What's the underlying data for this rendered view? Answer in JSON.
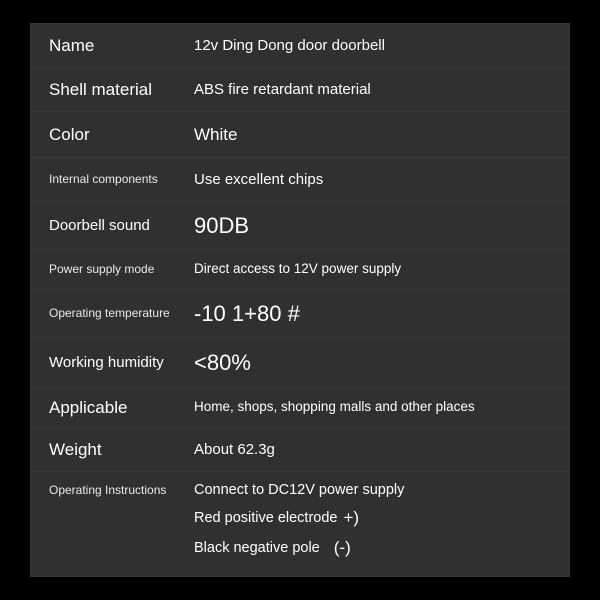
{
  "rows": {
    "name": {
      "label": "Name",
      "value": "12v Ding Dong door doorbell"
    },
    "shell": {
      "label": "Shell material",
      "value": "ABS fire retardant material"
    },
    "color": {
      "label": "Color",
      "value": "White"
    },
    "internal": {
      "label": "Internal components",
      "value": "Use excellent chips"
    },
    "sound": {
      "label": "Doorbell sound",
      "value": "90DB"
    },
    "power": {
      "label": "Power supply mode",
      "value": "Direct access to 12V power supply"
    },
    "temp": {
      "label": "Operating temperature",
      "value": "-10 1+80 #"
    },
    "humidity": {
      "label": "Working humidity",
      "value": "<80%"
    },
    "applicable": {
      "label": "Applicable",
      "value": "Home, shops, shopping malls and other places"
    },
    "weight": {
      "label": "Weight",
      "value": "About 62.3g"
    },
    "instructions": {
      "label": "Operating Instructions",
      "line1": "Connect to DC12V power supply",
      "line2_text": "Red positive electrode",
      "line2_sym": "+)",
      "line3_text": "Black negative pole",
      "line3_sym": "(-)"
    }
  }
}
